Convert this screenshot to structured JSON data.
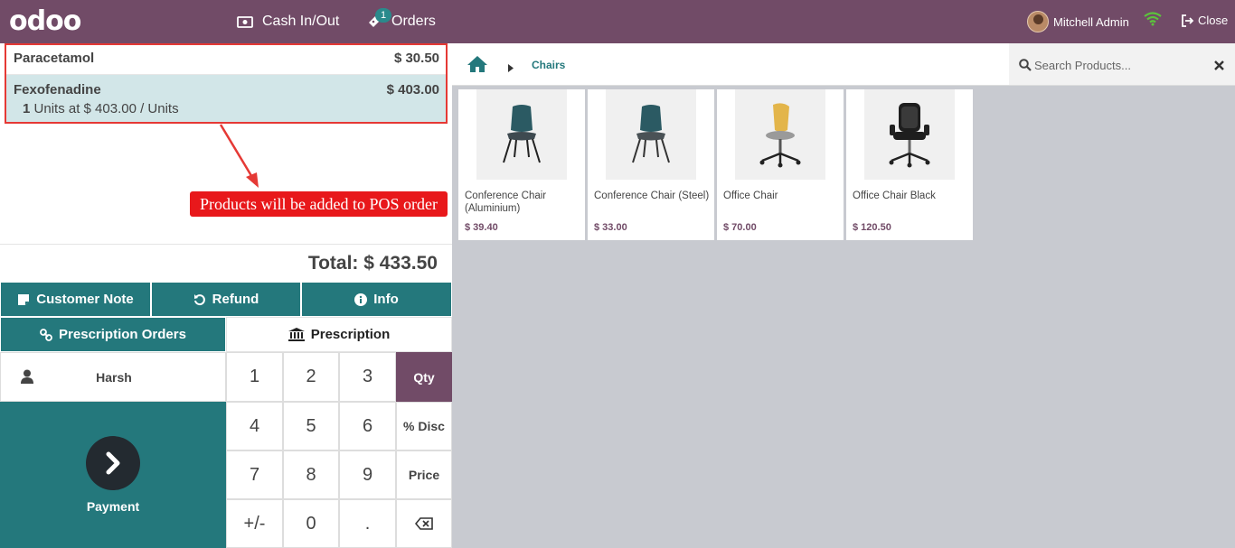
{
  "header": {
    "logo": "odoo",
    "cash_label": "Cash In/Out",
    "orders_label": "Orders",
    "orders_count": "1",
    "user_name": "Mitchell Admin",
    "close_label": "Close",
    "bg_color": "#714b67"
  },
  "order": {
    "lines": [
      {
        "name": "Paracetamol",
        "price": "$ 30.50"
      },
      {
        "name": "Fexofenadine",
        "price": "$ 403.00",
        "qty": "1",
        "detail": "Units at $ 403.00 / Units"
      }
    ],
    "total": "Total: $ 433.50"
  },
  "annotation": {
    "callout": "Products will be added to POS order"
  },
  "controls": {
    "customer_note": "Customer Note",
    "refund": "Refund",
    "info": "Info",
    "prescription_orders": "Prescription Orders",
    "prescription": "Prescription"
  },
  "partner": {
    "name": "Harsh"
  },
  "payment": {
    "label": "Payment"
  },
  "numpad": {
    "keys": [
      "1",
      "2",
      "3",
      "Qty",
      "4",
      "5",
      "6",
      "% Disc",
      "7",
      "8",
      "9",
      "Price",
      "+/-",
      "0",
      "."
    ],
    "active_mode": "Qty"
  },
  "breadcrumb": {
    "category": "Chairs"
  },
  "search": {
    "placeholder": "Search Products..."
  },
  "products": [
    {
      "name": "Conference Chair (Aluminium)",
      "price": "$ 39.40",
      "icon": "teal-chair"
    },
    {
      "name": "Conference Chair (Steel)",
      "price": "$ 33.00",
      "icon": "teal-chair"
    },
    {
      "name": "Office Chair",
      "price": "$ 70.00",
      "icon": "yellow-office-chair"
    },
    {
      "name": "Office Chair Black",
      "price": "$ 120.50",
      "icon": "black-office-chair"
    }
  ],
  "colors": {
    "accent": "#24787c",
    "brand": "#714b67",
    "callout": "#e8181b"
  }
}
